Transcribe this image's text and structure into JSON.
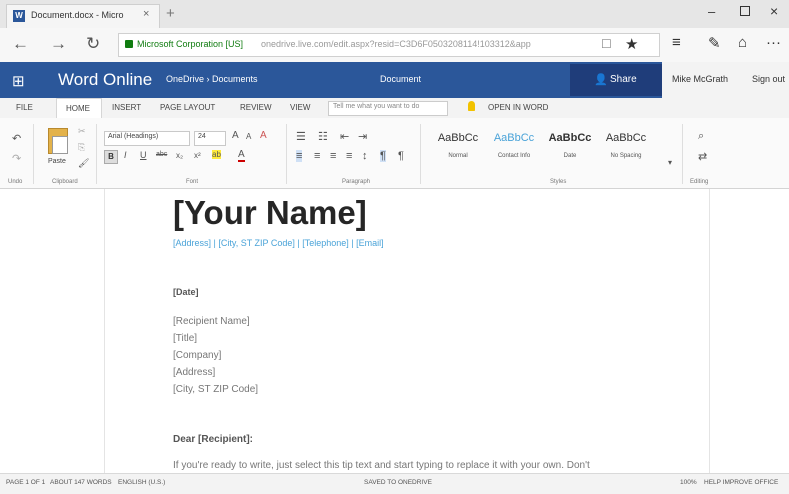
{
  "browser": {
    "tab_title": "Document.docx - Micro",
    "tab_icon_letter": "W",
    "close_glyph": "×",
    "new_tab_glyph": "+",
    "url_owner": "Microsoft Corporation [US]",
    "url_text": "onedrive.live.com/edit.aspx?resid=C3D6F0503208114!103312&app",
    "window_controls": {
      "minimize": "–",
      "close": "×"
    }
  },
  "nav": {
    "back": "←",
    "forward": "→",
    "refresh": "↻"
  },
  "toolbar_icons": {
    "reading": "☐",
    "favorite": "★",
    "hub": "≡",
    "note": "✎",
    "share": "⌂",
    "more": "···"
  },
  "app": {
    "waffle": "⊞",
    "name": "Word Online",
    "breadcrumb": "OneDrive › Documents",
    "document_title": "Document",
    "share_label": "Share",
    "share_icon": "👤",
    "user_name": "Mike McGrath",
    "sign_out": "Sign out"
  },
  "ribbon_tabs": {
    "file": "FILE",
    "home": "HOME",
    "insert": "INSERT",
    "page_layout": "PAGE LAYOUT",
    "review": "REVIEW",
    "view": "VIEW",
    "tell_me_placeholder": "Tell me what you want to do",
    "open_in_word": "OPEN IN WORD"
  },
  "ribbon": {
    "undo_label": "Undo",
    "clipboard_label": "Clipboard",
    "paste_label": "Paste",
    "font_label": "Font",
    "paragraph_label": "Paragraph",
    "styles_label": "Styles",
    "editing_label": "Editing",
    "font_name": "Arial (Headings)",
    "font_size": "24",
    "styles": [
      {
        "sample": "AaBbCc",
        "name": "Normal"
      },
      {
        "sample": "AaBbCc",
        "name": "Contact Info"
      },
      {
        "sample": "AaBbCc",
        "name": "Date"
      },
      {
        "sample": "AaBbCc",
        "name": "No Spacing"
      }
    ],
    "icons": {
      "undo": "↶",
      "redo": "↷",
      "cut": "✂",
      "copy": "⎘",
      "format_painter": "🖌",
      "bold": "B",
      "italic": "I",
      "underline": "U",
      "strikethrough": "abc",
      "subscript": "x₂",
      "superscript": "x²",
      "highlight": "ab",
      "font_color": "A",
      "grow": "A",
      "shrink": "A",
      "bullets": "☰",
      "numbering": "☷",
      "decrease_indent": "⇤",
      "increase_indent": "⇥",
      "align_left": "≡",
      "center": "≡",
      "align_right": "≡",
      "justify": "≡",
      "line_spacing": "↕",
      "ltr": "¶",
      "rtl": "¶",
      "find": "⌕",
      "replace": "⇄",
      "more_styles": "▾"
    }
  },
  "document": {
    "name": "[Your Name]",
    "contact": "[Address] | [City, ST ZIP Code] | [Telephone] | [Email]",
    "date": "[Date]",
    "recipient": [
      "[Recipient Name]",
      "[Title]",
      "[Company]",
      "[Address]",
      "[City, ST ZIP Code]"
    ],
    "salutation": "Dear [Recipient]:",
    "body": "If you're ready to write, just select this tip text and start typing to replace it with your own. Don't"
  },
  "status": {
    "page": "PAGE 1 OF 1",
    "words": "ABOUT 147 WORDS",
    "language": "ENGLISH (U.S.)",
    "save_state": "SAVED TO ONEDRIVE",
    "zoom": "100%",
    "feedback": "HELP IMPROVE OFFICE"
  },
  "colors": {
    "word_blue": "#2b579a",
    "share_blue": "#1f3d7a",
    "contact_blue": "#4aa3d8",
    "secure_green": "#107c10"
  }
}
